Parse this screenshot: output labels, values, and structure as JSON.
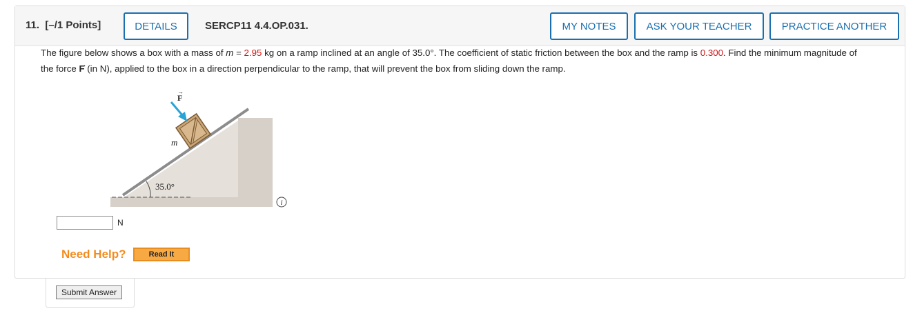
{
  "header": {
    "question_number": "11.",
    "points": "[–/1 Points]",
    "details_label": "DETAILS",
    "problem_code": "SERCP11 4.4.OP.031.",
    "my_notes_label": "MY NOTES",
    "ask_teacher_label": "ASK YOUR TEACHER",
    "practice_label": "PRACTICE ANOTHER"
  },
  "question": {
    "t1": "The figure below shows a box with a mass of ",
    "m_var": "m",
    "eq": " = ",
    "mass": "2.95",
    "t2": " kg on a ramp inclined at an angle of 35.0°. The coefficient of static friction between the box and the ramp is ",
    "mu": "0.300",
    "t3": ". Find the minimum magnitude of the force ",
    "force_symbol": "F",
    "t4": " (in N), applied to the box in a direction perpendicular to the ramp, that will prevent the box from sliding down the ramp."
  },
  "figure": {
    "force_label": "F",
    "mass_label": "m",
    "angle_label": "35.0°"
  },
  "answer": {
    "value": "",
    "unit": "N"
  },
  "help": {
    "need_help": "Need Help?",
    "read_it": "Read It"
  },
  "submit": {
    "label": "Submit Answer"
  },
  "colors": {
    "accent": "#1a6fae",
    "highlight": "#d21414",
    "help": "#f28c1f",
    "arrow": "#2aa3d6"
  }
}
